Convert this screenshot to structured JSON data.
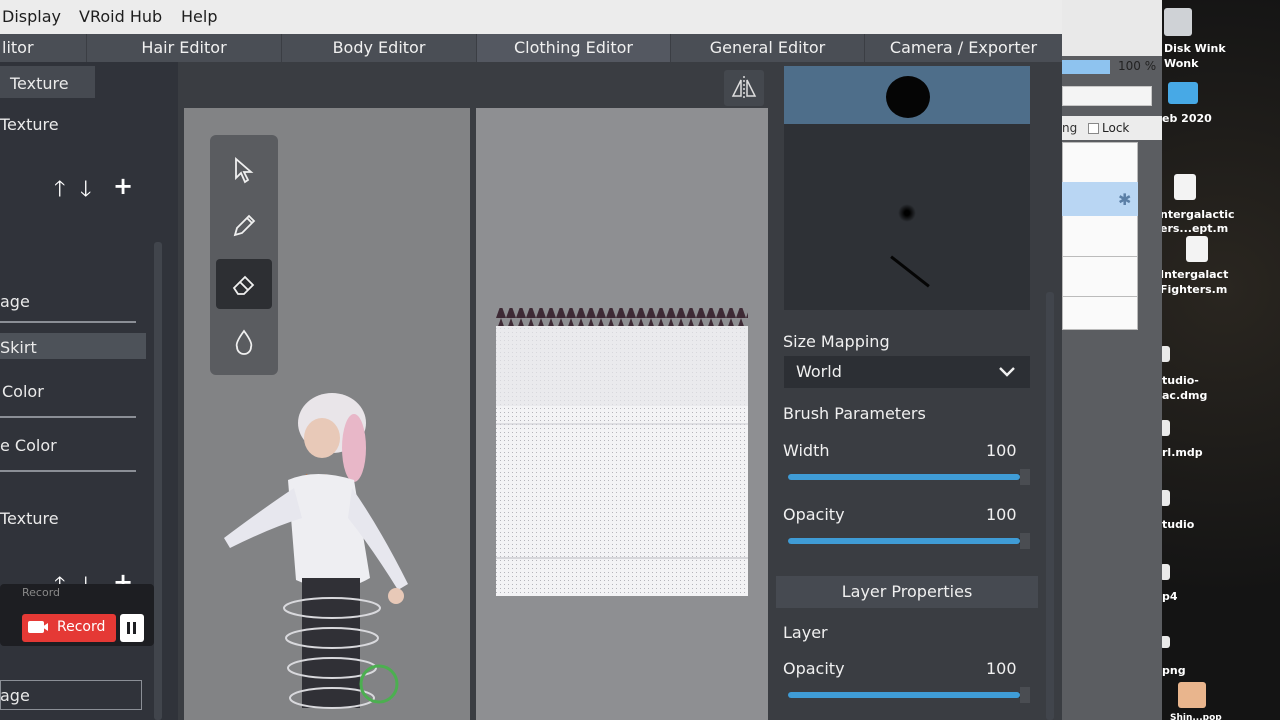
{
  "menu": {
    "display": "Display",
    "vroid_hub": "VRoid Hub",
    "help": "Help"
  },
  "tabs": [
    "litor",
    "Hair Editor",
    "Body Editor",
    "Clothing Editor",
    "General Editor",
    "Camera / Exporter"
  ],
  "left_panel": {
    "header": "Texture",
    "section_texture": "Texture",
    "image_label": "age",
    "skirt_item": "Skirt",
    "color_label": "Color",
    "shade_color_label": "e Color",
    "texture_label": "Texture",
    "bottom_image_label": "age"
  },
  "record": {
    "caption": "Record",
    "button": "Record"
  },
  "right_panel": {
    "size_mapping_label": "Size Mapping",
    "size_mapping_value": "World",
    "brush_params_title": "Brush Parameters",
    "width_label": "Width",
    "width_value": "100",
    "width_fraction": 1.0,
    "opacity_label": "Opacity",
    "opacity_value": "100",
    "opacity_fraction": 1.0,
    "layer_props_title": "Layer Properties",
    "layer_label": "Layer",
    "layer_opacity_label": "Opacity",
    "layer_opacity_value": "100",
    "layer_opacity_fraction": 1.0
  },
  "background_window": {
    "zoom": "100 %",
    "ing_label": "ng",
    "lock_label": "Lock"
  },
  "desktop": {
    "items": [
      "Disk Wink",
      "Wonk",
      "eb 2020",
      "ntergalactic",
      "ers...ept.m",
      "Intergalact",
      "Fighters.m",
      "tudio-",
      "ac.dmg",
      "rl.mdp",
      "tudio",
      "p4",
      "png",
      "Shin...pop"
    ]
  },
  "colors": {
    "accent": "#3f9cd6",
    "record_red": "#e53935",
    "panel_bg": "#3a3d42"
  }
}
